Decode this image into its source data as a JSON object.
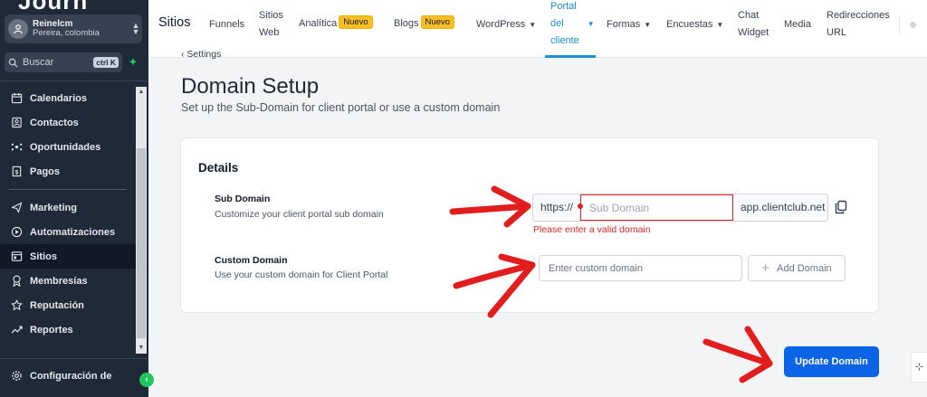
{
  "sidebar": {
    "logo_text": "Journ",
    "account": {
      "name": "Reinelcm",
      "location": "Pereira, colombia"
    },
    "search": {
      "placeholder": "Buscar",
      "shortcut": "ctrl K"
    },
    "items": [
      {
        "label": "Calendarios",
        "icon": "calendar-icon"
      },
      {
        "label": "Contactos",
        "icon": "contacts-icon"
      },
      {
        "label": "Oportunidades",
        "icon": "opportunities-icon"
      },
      {
        "label": "Pagos",
        "icon": "payments-icon"
      },
      {
        "label": "Marketing",
        "icon": "send-icon"
      },
      {
        "label": "Automatizaciones",
        "icon": "automation-icon"
      },
      {
        "label": "Sitios",
        "icon": "sites-icon",
        "active": true
      },
      {
        "label": "Membresías",
        "icon": "membership-icon"
      },
      {
        "label": "Reputación",
        "icon": "star-icon"
      },
      {
        "label": "Reportes",
        "icon": "chart-icon"
      }
    ],
    "settings_label": "Configuración de",
    "collapse_glyph": "‹"
  },
  "topnav": {
    "title": "Sitios",
    "funnels": "Funnels",
    "sitios_web_1": "Sitios",
    "sitios_web_2": "Web",
    "analitica": "Analítica",
    "nuevo": "Nuevo",
    "blogs": "Blogs",
    "wordpress": "WordPress",
    "portal_1": "Portal",
    "portal_2": "del",
    "portal_3": "cliente",
    "formas": "Formas",
    "encuestas": "Encuestas",
    "chat_1": "Chat",
    "chat_2": "Widget",
    "media": "Media",
    "redir_1": "Redirecciones",
    "redir_2": "URL"
  },
  "page": {
    "back_label": "Settings",
    "title": "Domain Setup",
    "subtitle": "Set up the Sub-Domain for client portal or use a custom domain"
  },
  "details": {
    "title": "Details",
    "sub_domain": {
      "label": "Sub Domain",
      "description": "Customize your client portal sub domain",
      "prefix": "https://",
      "placeholder": "Sub Domain",
      "value": "",
      "suffix": "app.clientclub.net",
      "error": "Please enter a valid domain"
    },
    "custom_domain": {
      "label": "Custom Domain",
      "description": "Use your custom domain for Client Portal",
      "placeholder": "Enter custom domain",
      "value": "",
      "add_label": "Add Domain"
    }
  },
  "actions": {
    "update_label": "Update Domain"
  },
  "colors": {
    "sidebar_bg": "#1f2937",
    "accent_blue": "#0b63e5",
    "tab_active": "#1d8fd7",
    "error_red": "#dc2626",
    "annotation_red": "#e11d1d",
    "badge_yellow": "#fbbf24"
  }
}
